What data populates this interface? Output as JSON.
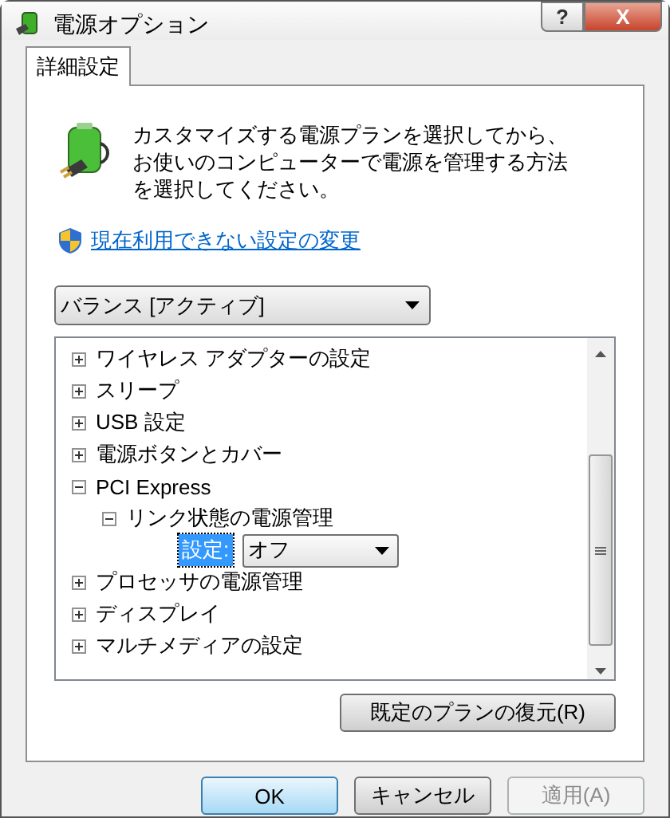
{
  "window": {
    "title": "電源オプション",
    "help_button": "?",
    "close_button": "X"
  },
  "tabs": [
    {
      "label": "詳細設定",
      "selected": true
    }
  ],
  "description": "カスタマイズする電源プランを選択してから、お使いのコンピューターで電源を管理する方法を選択してください。",
  "link": "現在利用できない設定の変更",
  "plan_dropdown": {
    "value": "バランス [アクティブ]"
  },
  "tree": {
    "items": [
      {
        "label": "ワイヤレス アダプターの設定",
        "expanded": false
      },
      {
        "label": "スリープ",
        "expanded": false
      },
      {
        "label": "USB 設定",
        "expanded": false
      },
      {
        "label": "電源ボタンとカバー",
        "expanded": false
      },
      {
        "label": "PCI Express",
        "expanded": true,
        "children": [
          {
            "label": "リンク状態の電源管理",
            "expanded": true,
            "children": [
              {
                "kind": "setting",
                "label": "設定:",
                "value": "オフ",
                "selected": true
              }
            ]
          }
        ]
      },
      {
        "label": "プロセッサの電源管理",
        "expanded": false
      },
      {
        "label": "ディスプレイ",
        "expanded": false
      },
      {
        "label": "マルチメディアの設定",
        "expanded": false
      }
    ]
  },
  "restore_button": {
    "label": "既定のプランの復元(R)",
    "disabled": false
  },
  "buttons": [
    {
      "label": "OK",
      "disabled": false,
      "default": true
    },
    {
      "label": "キャンセル",
      "disabled": false,
      "default": false
    },
    {
      "label": "適用(A)",
      "disabled": true,
      "default": false
    }
  ]
}
